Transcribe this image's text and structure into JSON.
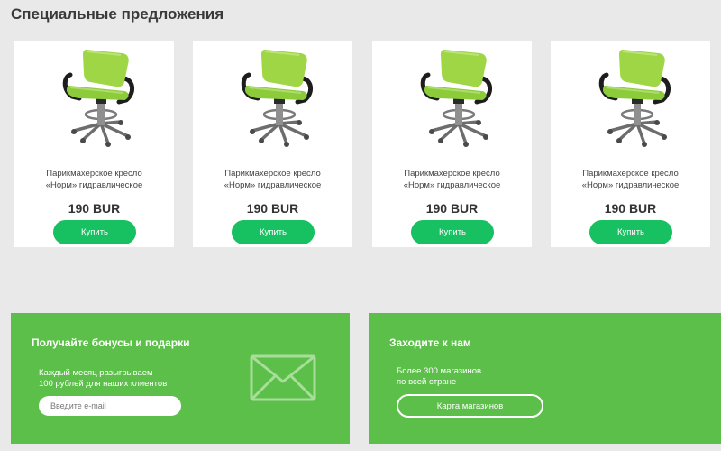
{
  "page": {
    "title": "Специальные предложения"
  },
  "products": [
    {
      "name_line1": "Парикмахерское кресло",
      "name_line2": "«Норм» гидравлическое",
      "price": "190 BUR",
      "button": "Купить",
      "image_icon": "salon-chair-image"
    },
    {
      "name_line1": "Парикмахерское кресло",
      "name_line2": "«Норм» гидравлическое",
      "price": "190 BUR",
      "button": "Купить",
      "image_icon": "salon-chair-image"
    },
    {
      "name_line1": "Парикмахерское кресло",
      "name_line2": "«Норм» гидравлическое",
      "price": "190 BUR",
      "button": "Купить",
      "image_icon": "salon-chair-image"
    },
    {
      "name_line1": "Парикмахерское кресло",
      "name_line2": "«Норм» гидравлическое",
      "price": "190 BUR",
      "button": "Купить",
      "image_icon": "salon-chair-image"
    }
  ],
  "bonus": {
    "title": "Получайте бонусы и подарки",
    "text_line1": "Каждый месяц разыгрываем",
    "text_line2": "100 рублей для наших клиентов",
    "email_placeholder": "Введите e-mail",
    "icon": "envelope-icon"
  },
  "stores": {
    "title": "Заходите к нам",
    "text_line1": "Более 300 магазинов",
    "text_line2": "по всей стране",
    "button": "Карта магазинов"
  },
  "colors": {
    "background": "#e9e9e9",
    "card": "#ffffff",
    "buy_button": "#17c060",
    "promo_green": "#5cbf4a",
    "chair_seat": "#9fd645",
    "chair_arm": "#1d1d1d",
    "chair_metal": "#8a8a8a"
  }
}
